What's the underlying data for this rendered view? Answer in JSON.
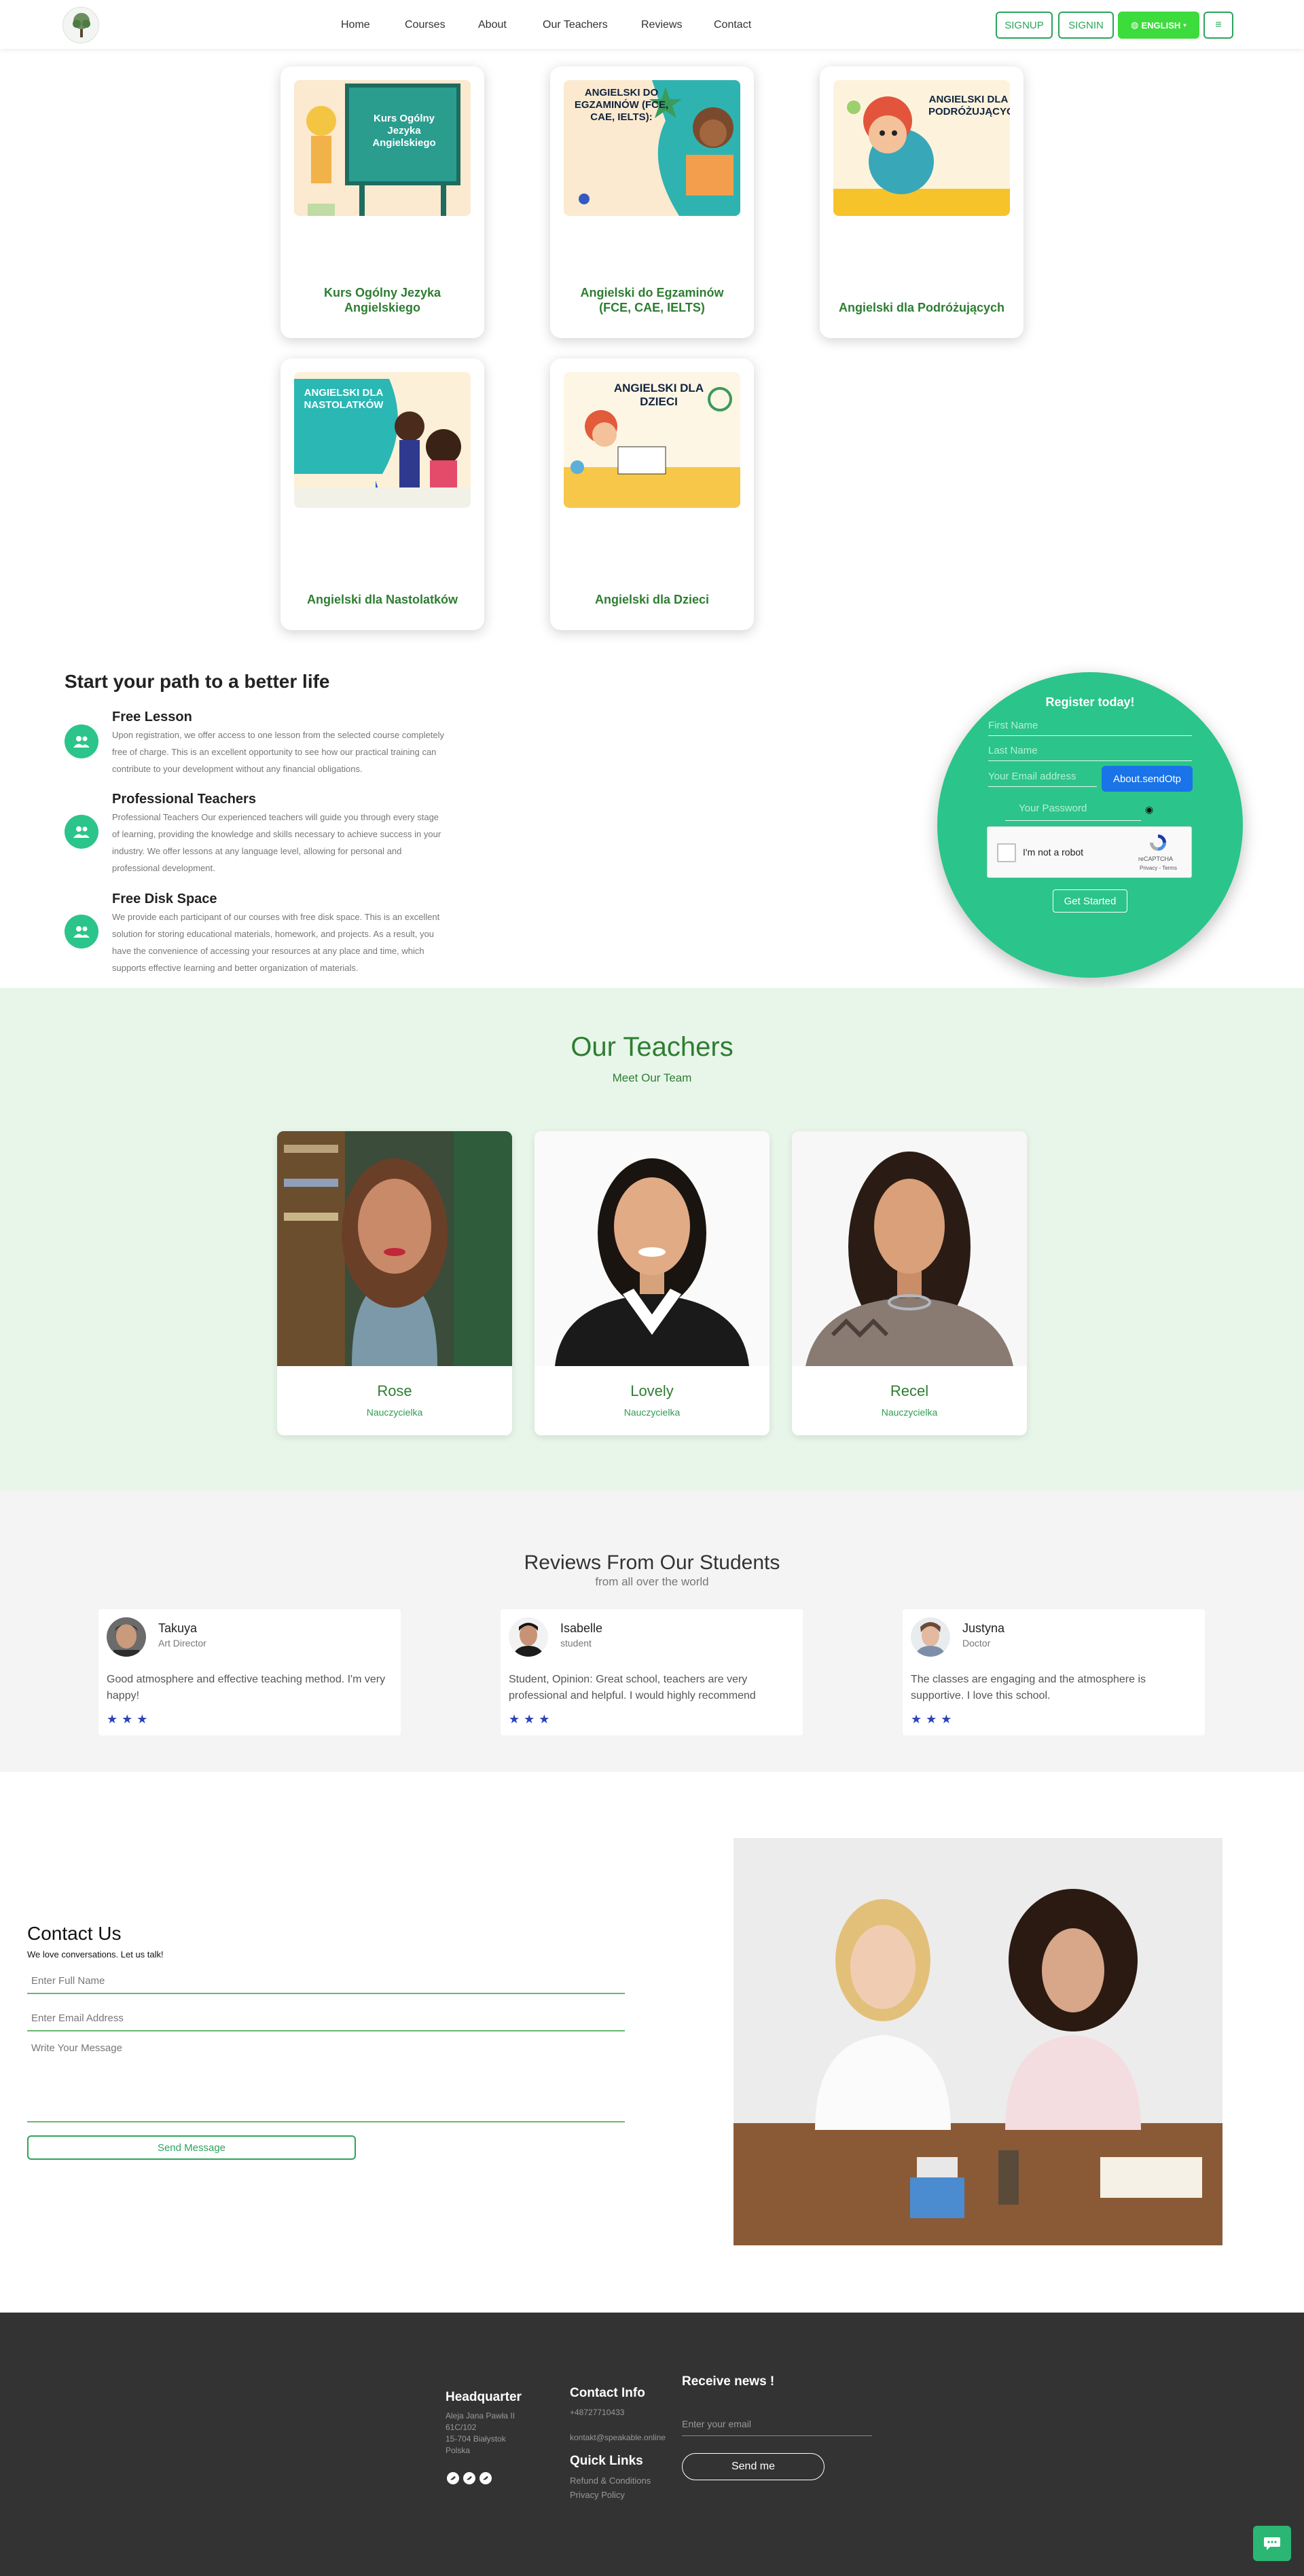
{
  "colors": {
    "brand_green": "#2aa55a",
    "accent_mint": "#2bc48a",
    "footer_bg": "#333333",
    "star_blue": "#2b43b8"
  },
  "nav": {
    "links": [
      "Home",
      "Courses",
      "About",
      "Our Teachers",
      "Reviews",
      "Contact"
    ],
    "signup": "SIGNUP",
    "signin": "SIGNIN",
    "language": "ENGLISH",
    "language_icon": "globe-icon",
    "menu_icon": "hamburger-icon",
    "logo_icon": "tree-logo-icon"
  },
  "courses": [
    {
      "title": "Kurs Ogólny Jezyka Angielskiego",
      "image_text": "Kurs Ogólny Jezyka Angielskiego"
    },
    {
      "title": "Angielski do Egzaminów (FCE, CAE, IELTS)",
      "image_text": "ANGIELSKI DO EGZAMINÓW (FCE, CAE, IELTS):"
    },
    {
      "title": "Angielski dla Podróżujących",
      "image_text": "ANGIELSKI DLA PODRÓŻUJĄCYCH"
    },
    {
      "title": "Angielski dla Nastolatków",
      "image_text": "ANGIELSKI DLA NASTOLATKÓW"
    },
    {
      "title": "Angielski dla Dzieci",
      "image_text": "ANGIELSKI DLA DZIECI"
    }
  ],
  "path": {
    "title": "Start your path to a better life",
    "features": [
      {
        "heading": "Free Lesson",
        "text": "Upon registration, we offer access to one lesson from the selected course completely free of charge. This is an excellent opportunity to see how our practical training can contribute to your development without any financial obligations.",
        "icon": "users-icon"
      },
      {
        "heading": "Professional Teachers",
        "text": "Professional Teachers Our experienced teachers will guide you through every stage of learning, providing the knowledge and skills necessary to achieve success in your industry. We offer lessons at any language level, allowing for personal and professional development.",
        "icon": "users-icon"
      },
      {
        "heading": "Free Disk Space",
        "text": "We provide each participant of our courses with free disk space. This is an excellent solution for storing educational materials, homework, and projects. As a result, you have the convenience of accessing your resources at any place and time, which supports effective learning and better organization of materials.",
        "icon": "users-icon"
      }
    ]
  },
  "register": {
    "title": "Register today!",
    "first_name": "First Name",
    "last_name": "Last Name",
    "email": "Your Email address",
    "otp_button": "About.sendOtp",
    "password": "Your Password",
    "password_icon": "eye-icon",
    "captcha_label": "I'm not a robot",
    "captcha_brand": "reCAPTCHA",
    "captcha_links": "Privacy - Terms",
    "submit": "Get Started"
  },
  "teachers": {
    "title": "Our Teachers",
    "subtitle": "Meet Our Team",
    "list": [
      {
        "name": "Rose",
        "role": "Nauczycielka"
      },
      {
        "name": "Lovely",
        "role": "Nauczycielka"
      },
      {
        "name": "Recel",
        "role": "Nauczycielka"
      }
    ]
  },
  "reviews": {
    "title": "Reviews From Our Students",
    "subtitle": "from all over the world",
    "list": [
      {
        "name": "Takuya",
        "role": "Art Director",
        "text": "Good atmosphere and effective teaching method. I'm very happy!",
        "stars": "★★★",
        "rating": 3
      },
      {
        "name": "Isabelle",
        "role": "student",
        "text": "Student, Opinion: Great school, teachers are very professional and helpful. I would highly recommend",
        "stars": "★★★",
        "rating": 3
      },
      {
        "name": "Justyna",
        "role": "Doctor",
        "text": "The classes are engaging and the atmosphere is supportive. I love this school.",
        "stars": "★★★",
        "rating": 3
      }
    ]
  },
  "contact": {
    "title": "Contact Us",
    "subtitle": "We love conversations. Let us talk!",
    "name_placeholder": "Enter Full Name",
    "email_placeholder": "Enter Email Address",
    "message_placeholder": "Write Your Message",
    "send": "Send Message"
  },
  "footer": {
    "hq_title": "Headquarter",
    "hq_lines": [
      "Aleja Jana Pawła II",
      "61C/102",
      "15-704 Białystok",
      "Polska"
    ],
    "contact_title": "Contact Info",
    "phone": "+48727710433",
    "email": "kontakt@speakable.online",
    "links_title": "Quick Links",
    "links": [
      "Refund & Conditions",
      "Privacy Policy"
    ],
    "news_title": "Receive news !",
    "news_placeholder": "Enter your email",
    "news_button": "Send me",
    "social_icons": [
      "twitter-icon",
      "twitter-icon",
      "twitter-icon"
    ],
    "chat_icon": "chat-icon"
  }
}
